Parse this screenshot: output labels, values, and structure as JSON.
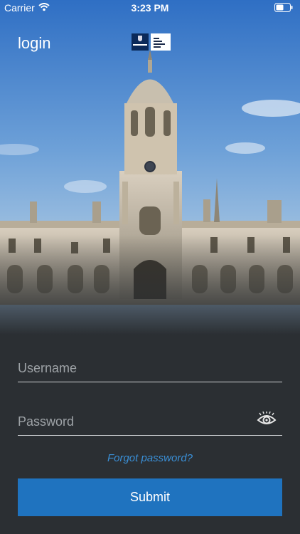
{
  "status_bar": {
    "carrier": "Carrier",
    "time": "3:23 PM",
    "wifi_icon": "wifi-icon",
    "battery_icon": "battery-icon"
  },
  "header": {
    "title": "login",
    "logos": [
      "oxford-university-logo",
      "said-business-school-logo"
    ]
  },
  "form": {
    "username": {
      "value": "",
      "placeholder": "Username"
    },
    "password": {
      "value": "",
      "placeholder": "Password",
      "toggle_icon": "eye-icon"
    },
    "forgot_password_label": "Forgot password?",
    "submit_label": "Submit"
  },
  "colors": {
    "background": "#2b2f33",
    "accent": "#1f73bf",
    "link": "#3a8fd6",
    "underline": "#cfd2d4"
  }
}
